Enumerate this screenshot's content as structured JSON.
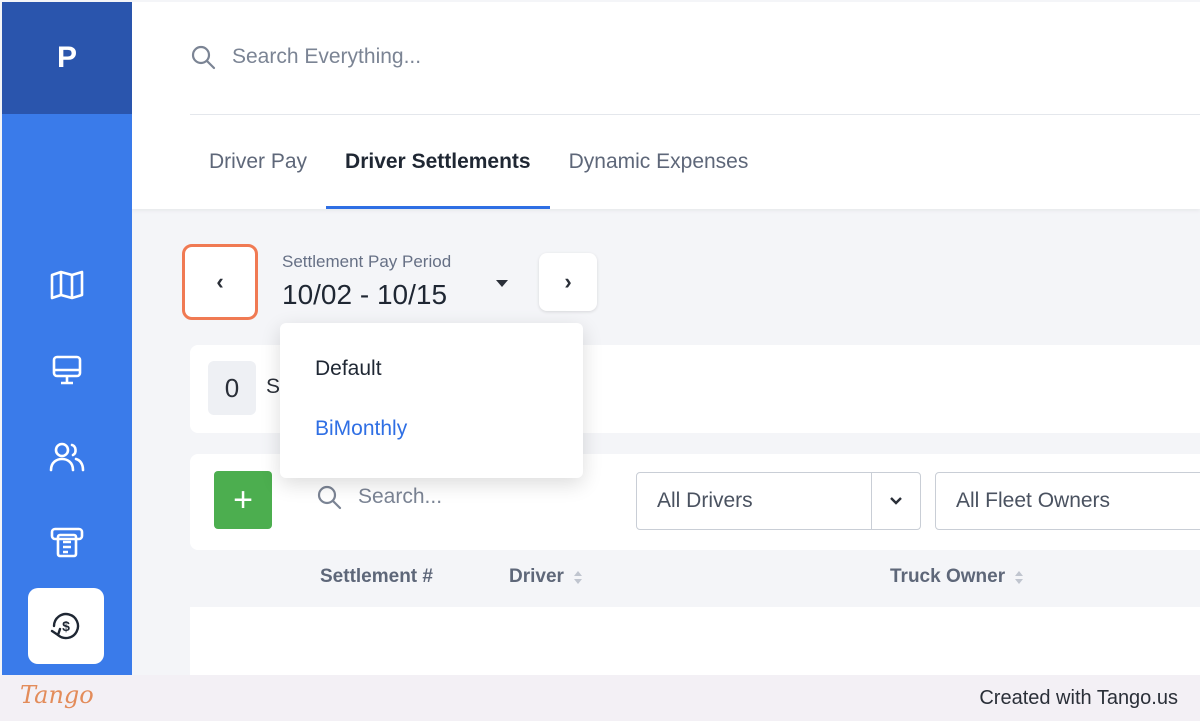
{
  "app": {
    "logo_letter": "P",
    "accent_color": "#3a7bea",
    "logo_bg": "#2a55ad"
  },
  "sidebar": {
    "items": [
      {
        "icon": "map-icon"
      },
      {
        "icon": "monitor-icon"
      },
      {
        "icon": "users-icon"
      },
      {
        "icon": "receipt-icon"
      },
      {
        "icon": "settlement-icon",
        "active": true
      }
    ]
  },
  "search": {
    "placeholder": "Search Everything..."
  },
  "tabs": [
    {
      "label": "Driver Pay",
      "active": false
    },
    {
      "label": "Driver Settlements",
      "active": true
    },
    {
      "label": "Dynamic Expenses",
      "active": false
    }
  ],
  "period": {
    "label": "Settlement Pay Period",
    "value": "10/02 - 10/15",
    "prev_glyph": "‹",
    "next_glyph": "›"
  },
  "dropdown": {
    "options": [
      {
        "label": "Default",
        "selected": false
      },
      {
        "label": "BiMonthly",
        "selected": true
      }
    ]
  },
  "summary": {
    "count": "0",
    "text_visible": "S"
  },
  "toolbar": {
    "add_glyph": "+",
    "add_color": "#4cae4f",
    "search_placeholder": "Search...",
    "drivers_filter": "All Drivers",
    "fleet_filter": "All Fleet Owners"
  },
  "table": {
    "columns": [
      "Settlement #",
      "Driver",
      "Truck Owner"
    ]
  },
  "footer": {
    "logo": "Tango",
    "credit": "Created with Tango.us"
  }
}
